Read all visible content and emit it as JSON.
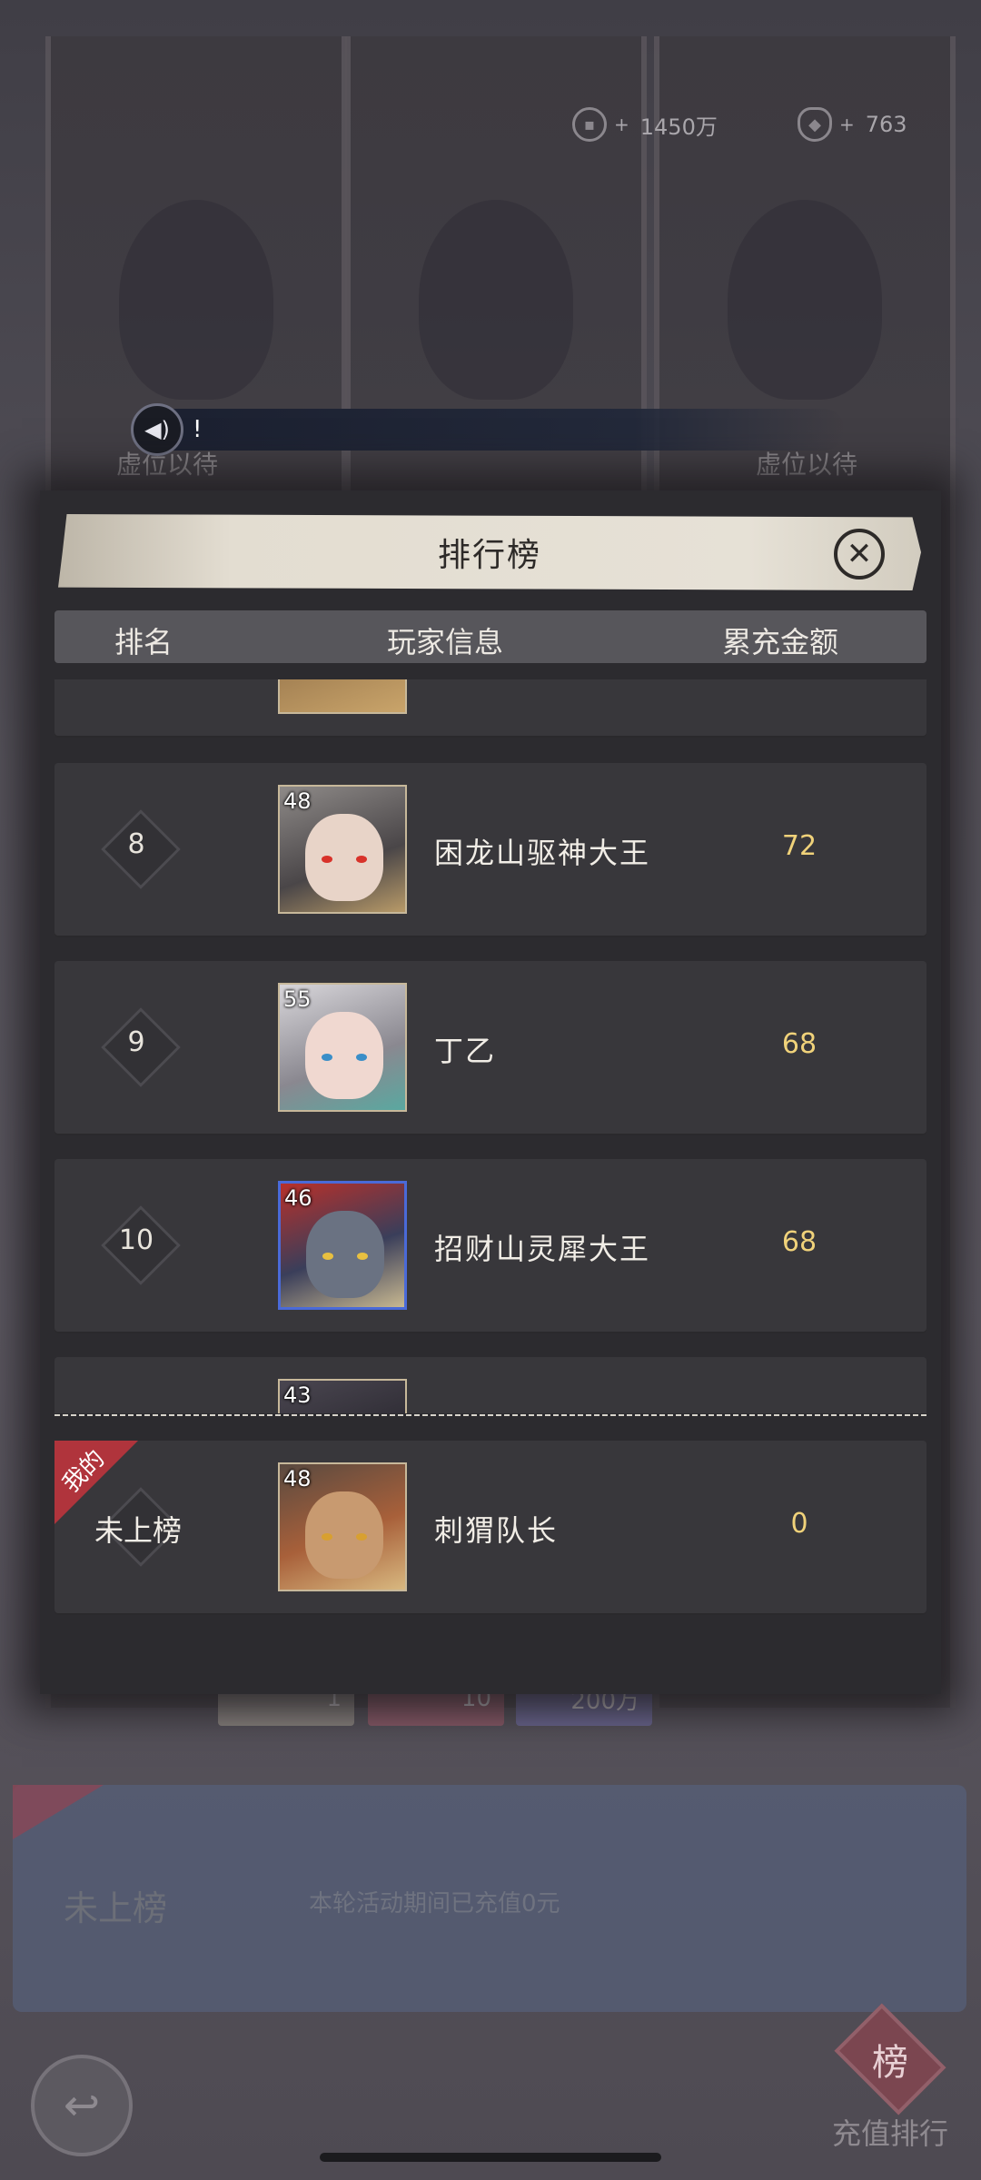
{
  "resources": {
    "coins": "1450万",
    "ingots": "763",
    "plus": "+"
  },
  "background": {
    "vacant_label": "虚位以待",
    "marquee_text": "!",
    "rewards": [
      "1",
      "10",
      "200万"
    ],
    "my_rank": "未上榜",
    "my_note": "本轮活动期间已充值0元",
    "my_badge": "我的",
    "rank_button_label": "充值排行",
    "rank_button_glyph": "榜"
  },
  "dialog": {
    "title": "排行榜",
    "columns": {
      "rank": "排名",
      "player": "玩家信息",
      "amount": "累充金额"
    },
    "rows": [
      {
        "rank": "8",
        "level": "48",
        "name": "困龙山驱神大王",
        "amount": "72"
      },
      {
        "rank": "9",
        "level": "55",
        "name": "丁乙",
        "amount": "68"
      },
      {
        "rank": "10",
        "level": "46",
        "name": "招财山灵犀大王",
        "amount": "68"
      }
    ],
    "partial_next_level": "43",
    "my_row": {
      "badge": "我的",
      "rank": "未上榜",
      "level": "48",
      "name": "刺猬队长",
      "amount": "0"
    }
  },
  "colors": {
    "amount": "#f0d27a",
    "badge": "#b0343c"
  },
  "icons": [
    "coin-icon",
    "ingot-icon",
    "speaker-icon",
    "close-icon",
    "back-arrow-icon",
    "ranking-emblem-icon"
  ]
}
